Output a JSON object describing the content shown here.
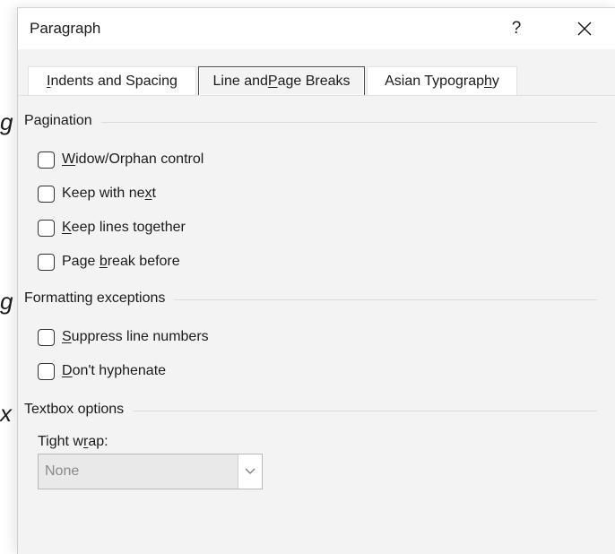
{
  "background_glyphs": [
    "g",
    "g",
    "x"
  ],
  "dialog": {
    "title": "Paragraph",
    "help_label": "?",
    "close_icon": "close-icon"
  },
  "tabs": [
    {
      "label_pre": "",
      "label_mn": "I",
      "label_post": "ndents and Spacing",
      "active": false
    },
    {
      "label_pre": "Line and ",
      "label_mn": "P",
      "label_post": "age Breaks",
      "active": true
    },
    {
      "label_pre": "Asian Typograp",
      "label_mn": "h",
      "label_post": "y",
      "active": false
    }
  ],
  "pagination": {
    "heading": "Pagination",
    "items": [
      {
        "pre": "",
        "mn": "W",
        "post": "idow/Orphan control",
        "checked": false
      },
      {
        "pre": "Keep with ne",
        "mn": "x",
        "post": "t",
        "checked": false
      },
      {
        "pre": "",
        "mn": "K",
        "post": "eep lines together",
        "checked": false
      },
      {
        "pre": "Page ",
        "mn": "b",
        "post": "reak before",
        "checked": false
      }
    ]
  },
  "formatting": {
    "heading": "Formatting exceptions",
    "items": [
      {
        "pre": "",
        "mn": "S",
        "post": "uppress line numbers",
        "checked": false
      },
      {
        "pre": "",
        "mn": "D",
        "post": "on't hyphenate",
        "checked": false
      }
    ]
  },
  "textbox": {
    "heading": "Textbox options",
    "tight_wrap_label_pre": "Tight w",
    "tight_wrap_label_mn": "r",
    "tight_wrap_label_post": "ap:",
    "tight_wrap_value": "None",
    "disabled": true
  },
  "colors": {
    "dialog_bg": "#f3f3f3",
    "titlebar_bg": "#ffffff",
    "disabled_text": "#8a8a8a"
  }
}
